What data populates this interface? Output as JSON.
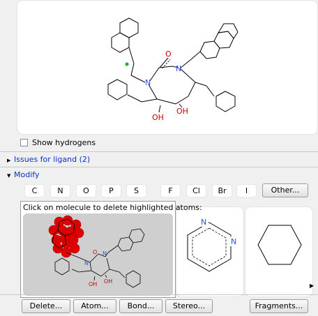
{
  "molecule": {
    "labels": {
      "nitrogen": "N",
      "oxygen": "O",
      "hydroxyl": "OH"
    }
  },
  "show_hydrogens": {
    "label": "Show hydrogens",
    "checked": false
  },
  "sections": {
    "issues": {
      "label": "Issues for ligand (2)",
      "expanded": false
    },
    "modify": {
      "label": "Modify",
      "expanded": true
    }
  },
  "atom_buttons": [
    "C",
    "N",
    "O",
    "P",
    "S",
    "F",
    "Cl",
    "Br",
    "I"
  ],
  "other_button": "Other...",
  "tooltip": {
    "text": "Click on molecule to delete highlighted atoms:"
  },
  "fragments": {
    "pyrimidine_n": "N"
  },
  "action_buttons": {
    "delete": "Delete...",
    "atom": "Atom...",
    "bond": "Bond...",
    "stereo": "Stereo...",
    "fragments": "Fragments..."
  },
  "colors": {
    "link": "#0033cc",
    "nitrogen": "#3050f8",
    "oxygen": "#cc0000",
    "highlight": "#e00000",
    "selection": "#00bb00"
  }
}
